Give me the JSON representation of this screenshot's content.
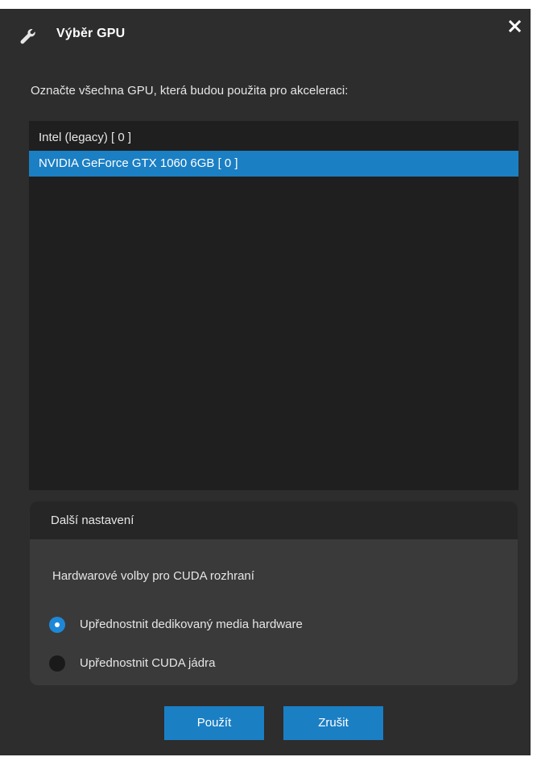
{
  "dialog": {
    "title": "Výběr GPU",
    "title_icon": "wrench-icon",
    "close_icon": "close-icon"
  },
  "instruction": "Označte všechna GPU, která budou použita pro akceleraci:",
  "gpu_list": {
    "items": [
      {
        "label": "Intel (legacy) [ 0 ]",
        "selected": false
      },
      {
        "label": "NVIDIA GeForce GTX 1060 6GB [ 0 ]",
        "selected": true
      }
    ]
  },
  "settings": {
    "header": "Další nastavení",
    "subtitle": "Hardwarové volby pro CUDA rozhraní",
    "options": [
      {
        "label": "Upřednostnit dedikovaný media hardware",
        "checked": true
      },
      {
        "label": "Upřednostnit CUDA jádra",
        "checked": false
      }
    ]
  },
  "buttons": {
    "apply": "Použít",
    "cancel": "Zrušit"
  },
  "colors": {
    "background": "#2d2d2d",
    "list_background": "#1f1f1f",
    "accent": "#1b7fc4",
    "panel": "#3a3a3a"
  }
}
